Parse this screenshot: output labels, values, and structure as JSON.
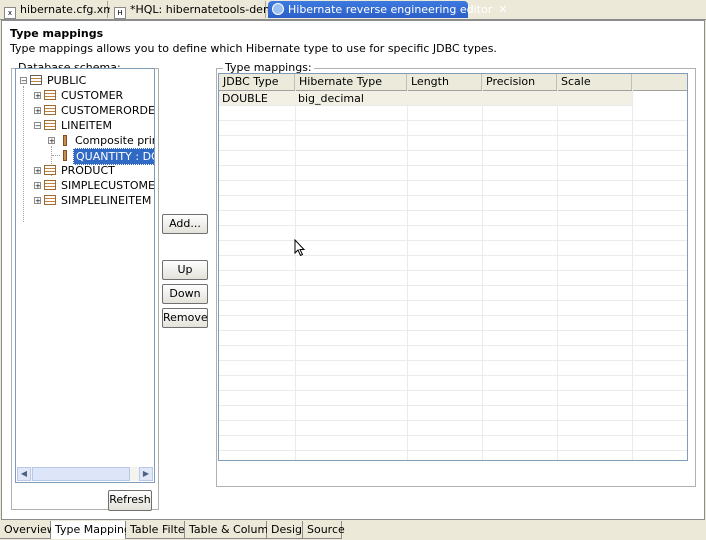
{
  "tabs": [
    {
      "label": "hibernate.cfg.xml",
      "icon": "xml-file-icon"
    },
    {
      "label": "*HQL: hibernatetools-demo",
      "icon": "hql-editor-icon"
    },
    {
      "label": "Hibernate reverse engineering editor",
      "icon": "hibernate-icon",
      "close": "✕"
    }
  ],
  "section": {
    "title": "Type mappings",
    "description": "Type mappings allows you to define which Hibernate type to use for specific JDBC types."
  },
  "schema": {
    "label": "Database schema:",
    "root": "PUBLIC",
    "items": [
      "CUSTOMER",
      "CUSTOMERORDER",
      "LINEITEM",
      "Composite prima",
      "QUANTITY : DOU",
      "PRODUCT",
      "SIMPLECUSTOMERC",
      "SIMPLELINEITEM"
    ],
    "refresh": "Refresh"
  },
  "buttons": {
    "add": "Add...",
    "up": "Up",
    "down": "Down",
    "remove": "Remove"
  },
  "mappings": {
    "label": "Type mappings:",
    "columns": [
      "JDBC Type",
      "Hibernate Type",
      "Length",
      "Precision",
      "Scale"
    ],
    "rows": [
      [
        "DOUBLE",
        "big_decimal",
        "",
        "",
        ""
      ]
    ]
  },
  "bottom_tabs": [
    "Overview",
    "Type Mappings",
    "Table Filters",
    "Table & Columns",
    "Design",
    "Source"
  ],
  "active_bottom_tab": "Type Mappings",
  "colors": {
    "selection": "#316ac5",
    "active_tab": "#2c5fc8",
    "row_highlight": "#f2f0e4"
  }
}
